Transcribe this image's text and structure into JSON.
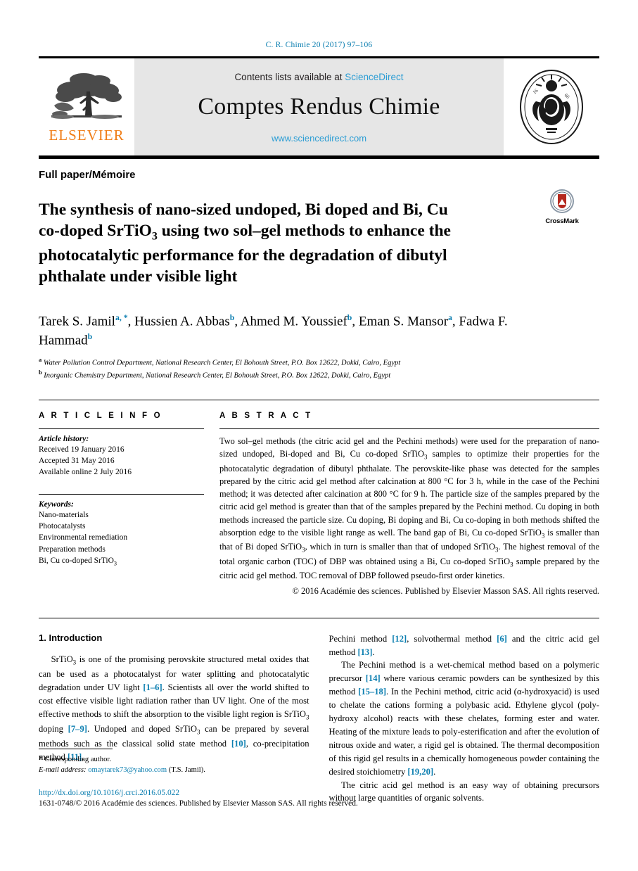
{
  "running_head": "C. R. Chimie 20 (2017) 97–106",
  "masthead": {
    "contents_prefix": "Contents lists available at ",
    "sciencedirect": "ScienceDirect",
    "journal_name": "Comptes Rendus Chimie",
    "url": "www.sciencedirect.com",
    "publisher_wordmark": "ELSEVIER",
    "publisher_logo_name": "elsevier-tree-logo",
    "seal_name": "academie-des-sciences-seal",
    "seal_text_top": "INSTITUT DE FRANCE",
    "seal_text_bottom": "ACADÉMIE DES SCIENCES",
    "seal_year": "1666",
    "banner_bg": "#e6e6e6",
    "accent_blue": "#2b9dd4",
    "elsevier_orange": "#f07f1a"
  },
  "article_type": "Full paper/Mémoire",
  "title": {
    "line1": "The synthesis of nano-sized undoped, Bi doped and Bi, Cu",
    "line2_a": "co-doped SrTiO",
    "line2_sub": "3",
    "line2_b": " using two sol–gel methods to enhance the",
    "line3": "photocatalytic performance for the degradation of dibutyl",
    "line4": "phthalate under visible light"
  },
  "crossmark": {
    "label": "CrossMark",
    "icon_name": "crossmark-badge-icon"
  },
  "authors": {
    "list": [
      {
        "name": "Tarek S. Jamil",
        "sup": "a, *"
      },
      {
        "name": "Hussien A. Abbas",
        "sup": "b"
      },
      {
        "name": "Ahmed M. Youssief",
        "sup": "b"
      },
      {
        "name": "Eman S. Mansor",
        "sup": "a"
      },
      {
        "name": "Fadwa F. Hammad",
        "sup": "b"
      }
    ]
  },
  "affiliations": [
    {
      "marker": "a",
      "text": "Water Pollution Control Department, National Research Center, El Bohouth Street, P.O. Box 12622, Dokki, Cairo, Egypt"
    },
    {
      "marker": "b",
      "text": "Inorganic Chemistry Department, National Research Center, El Bohouth Street, P.O. Box 12622, Dokki, Cairo, Egypt"
    }
  ],
  "article_info": {
    "heading": "A R T I C L E  I N F O",
    "history_label": "Article history:",
    "history": [
      "Received 19 January 2016",
      "Accepted 31 May 2016",
      "Available online 2 July 2016"
    ],
    "keywords_label": "Keywords:",
    "keywords": [
      "Nano-materials",
      "Photocatalysts",
      "Environmental remediation",
      "Preparation methods"
    ],
    "keyword_last_a": "Bi, Cu co-doped SrTiO",
    "keyword_last_sub": "3"
  },
  "abstract": {
    "heading": "A B S T R A C T",
    "p1": "Two sol–gel methods (the citric acid gel and the Pechini methods) were used for the preparation of nano-sized undoped, Bi-doped and Bi, Cu co-doped SrTiO",
    "p2": " samples to optimize their properties for the photocatalytic degradation of dibutyl phthalate. The perovskite-like phase was detected for the samples prepared by the citric acid gel method after calcination at 800 °C for 3 h, while in the case of the Pechini method; it was detected after calcination at 800 °C for 9 h. The particle size of the samples prepared by the citric acid gel method is greater than that of the samples prepared by the Pechini method. Cu doping in both methods increased the particle size. Cu doping, Bi doping and Bi, Cu co-doping in both methods shifted the absorption edge to the visible light range as well. The band gap of Bi, Cu co-doped SrTiO",
    "p3": " is smaller than that of Bi doped SrTiO",
    "p4": ", which in turn is smaller than that of undoped SrTiO",
    "p5": ". The highest removal of the total organic carbon (TOC) of DBP was obtained using a Bi, Cu co-doped SrTiO",
    "p6": " sample prepared by the citric acid gel method. TOC removal of DBP followed pseudo-first order kinetics.",
    "sub": "3",
    "copyright": "© 2016 Académie des sciences. Published by Elsevier Masson SAS. All rights reserved."
  },
  "body": {
    "section_heading": "1. Introduction",
    "left": {
      "p1_a": "SrTiO",
      "p1_sub1": "3",
      "p1_b": " is one of the promising perovskite structured metal oxides that can be used as a photocatalyst for water splitting and photocatalytic degradation under UV light ",
      "p1_ref1": "[1–6]",
      "p1_c": ". Scientists all over the world shifted to cost effective visible light radiation rather than UV light. One of the most effective methods to shift the absorption to the visible light region is SrTiO",
      "p1_sub2": "3",
      "p1_d": " doping ",
      "p1_ref2": "[7–9]",
      "p1_e": ". Undoped and doped SrTiO",
      "p1_sub3": "3",
      "p1_f": " can be prepared by several methods such as the classical solid state method ",
      "p1_ref3": "[10]",
      "p1_g": ", co-precipitation method ",
      "p1_ref4": "[11]",
      "p1_h": ","
    },
    "right": {
      "p1_a": "Pechini method ",
      "p1_ref1": "[12]",
      "p1_b": ", solvothermal method ",
      "p1_ref2": "[6]",
      "p1_c": " and the citric acid gel method ",
      "p1_ref3": "[13]",
      "p1_d": ".",
      "p2_a": "The Pechini method is a wet-chemical method based on a polymeric precursor ",
      "p2_ref1": "[14]",
      "p2_b": " where various ceramic powders can be synthesized by this method ",
      "p2_ref2": "[15–18]",
      "p2_c": ". In the Pechini method, citric acid (α-hydroxyacid) is used to chelate the cations forming a polybasic acid. Ethylene glycol (poly-hydroxy alcohol) reacts with these chelates, forming ester and water. Heating of the mixture leads to poly-esterification and after the evolution of nitrous oxide and water, a rigid gel is obtained. The thermal decomposition of this rigid gel results in a chemically homogeneous powder containing the desired stoichiometry ",
      "p2_ref3": "[19,20]",
      "p2_d": ".",
      "p3": "The citric acid gel method is an easy way of obtaining precursors without large quantities of organic solvents."
    }
  },
  "footnote": {
    "star": "*",
    "corresponding": "Corresponding author.",
    "email_label": "E-mail address:",
    "email": "omaytarek73@yahoo.com",
    "email_owner": "(T.S. Jamil)."
  },
  "footer": {
    "doi": "http://dx.doi.org/10.1016/j.crci.2016.05.022",
    "issn": "1631-0748/© 2016 Académie des sciences. Published by Elsevier Masson SAS. All rights reserved."
  }
}
